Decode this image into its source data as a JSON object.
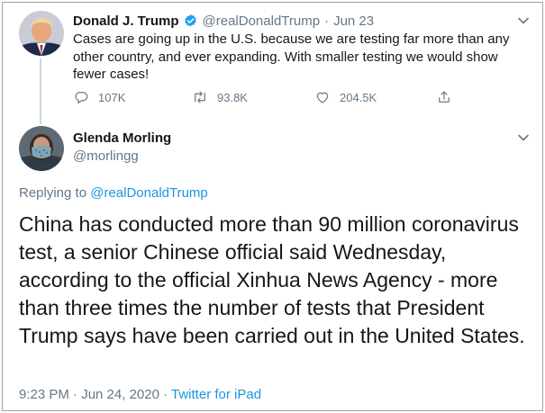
{
  "tweet": {
    "display_name": "Donald J. Trump",
    "handle": "@realDonaldTrump",
    "separator": "·",
    "time": "Jun 23",
    "text": "Cases are going up in the U.S. because we are testing far more than any other country, and ever expanding. With smaller testing we would show fewer cases!",
    "actions": {
      "replies": "107K",
      "retweets": "93.8K",
      "likes": "204.5K"
    }
  },
  "reply": {
    "display_name": "Glenda Morling",
    "handle": "@morlingg",
    "replying_label": "Replying to",
    "replying_handle": "@realDonaldTrump",
    "text": "China has conducted more than 90 million coronavirus test, a senior Chinese official said Wednesday, according to the official Xinhua News Agency - more than three times the number of tests that President Trump says have been carried out in the United States.",
    "timestamp": "9:23 PM · Jun 24, 2020",
    "meta_separator": "·",
    "source": "Twitter for iPad"
  },
  "colors": {
    "text_primary": "#14171a",
    "text_secondary": "#657786",
    "link": "#1b95e0",
    "verified_badge": "#1da1f2",
    "thread_line": "#ccd6dd"
  },
  "icons": {
    "verified": "verified-badge-icon",
    "menu": "chevron-down-icon",
    "reply": "reply-icon",
    "retweet": "retweet-icon",
    "like": "heart-icon",
    "share": "share-icon"
  }
}
